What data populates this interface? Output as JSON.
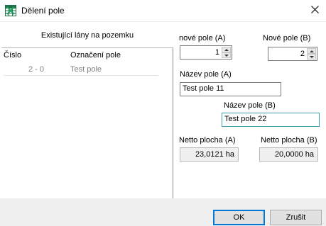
{
  "window": {
    "title": "Dělení pole",
    "icon": "excel-grid-icon",
    "close_glyph": "✕"
  },
  "left": {
    "title": "Existující lány na pozemku",
    "columns": [
      "Číslo",
      "Označení pole"
    ],
    "rows": [
      {
        "cislo": "2 - 0",
        "oznaceni": "Test pole"
      }
    ]
  },
  "right": {
    "nove_pole_a": {
      "label": "nové pole (A)",
      "value": "1"
    },
    "nove_pole_b": {
      "label": "Nové pole (B)",
      "value": "2"
    },
    "nazev_a": {
      "label": "Název pole (A)",
      "value": "Test pole 11"
    },
    "nazev_b": {
      "label": "Název pole (B)",
      "value": "Test pole 22"
    },
    "netto_a": {
      "label": "Netto plocha (A)",
      "value": "23,0121 ha"
    },
    "netto_b": {
      "label": "Netto plocha (B)",
      "value": "20,0000 ha"
    }
  },
  "footer": {
    "ok_label": "OK",
    "cancel_label": "Zrušit"
  },
  "colors": {
    "accent": "#0078d7",
    "focus_border": "#3c9db0",
    "footer_bg": "#f0f0f0",
    "muted_text": "#808080"
  }
}
